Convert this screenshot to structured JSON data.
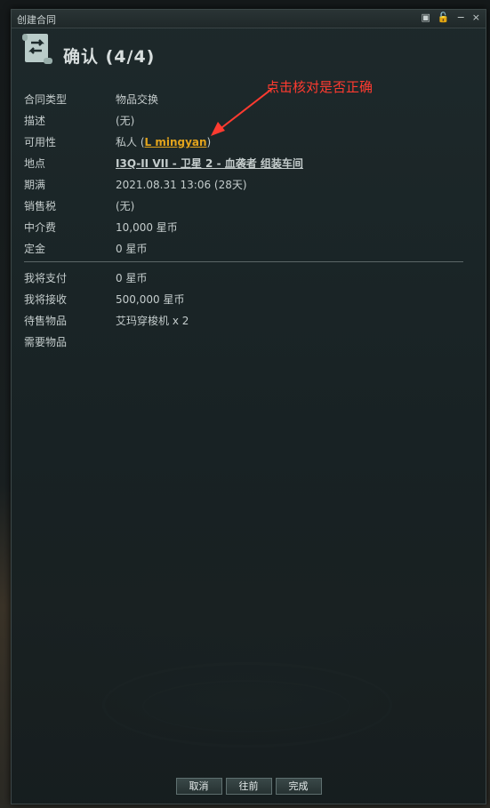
{
  "window": {
    "title": "创建合同",
    "controls": [
      "▣",
      "🔓",
      "−",
      "×"
    ]
  },
  "header": {
    "text": "确认 (4/4)",
    "icon": "contract-scroll-icon"
  },
  "annotation": {
    "text": "点击核对是否正确",
    "color": "#ff3b30"
  },
  "details": {
    "contract_type": {
      "label": "合同类型",
      "value": "物品交换"
    },
    "description": {
      "label": "描述",
      "value": "(无)"
    },
    "availability": {
      "label": "可用性",
      "value_prefix": "私人 (",
      "link": "L mingyan",
      "value_suffix": ")"
    },
    "location": {
      "label": "地点",
      "link": "I3Q-II VII - 卫星 2 - 血袭者 组装车间"
    },
    "expiration": {
      "label": "期满",
      "value": "2021.08.31 13:06 (28天)"
    },
    "sales_tax": {
      "label": "销售税",
      "value": "(无)"
    },
    "broker_fee": {
      "label": "中介费",
      "value": "10,000 星币"
    },
    "deposit": {
      "label": "定金",
      "value": "0 星币"
    }
  },
  "summary": {
    "will_pay": {
      "label": "我将支付",
      "value": "0 星币"
    },
    "will_receive": {
      "label": "我将接收",
      "value": "500,000 星币"
    },
    "items_for_sale": {
      "label": "待售物品",
      "value": "艾玛穿梭机 x 2"
    },
    "items_required": {
      "label": "需要物品",
      "value": ""
    }
  },
  "buttons": {
    "cancel": "取消",
    "back": "往前",
    "finish": "完成"
  },
  "colors": {
    "link": "#e3a41c",
    "text": "#c4cccc"
  }
}
